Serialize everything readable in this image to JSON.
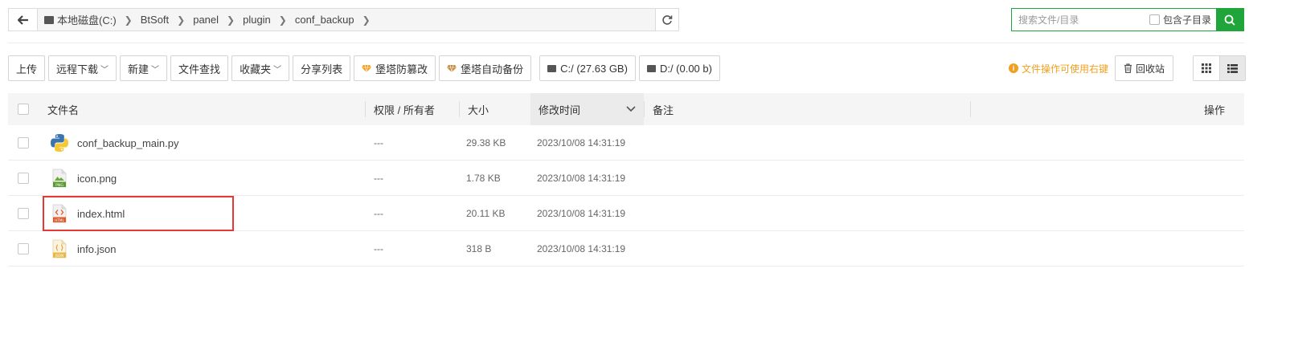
{
  "pathbar": {
    "crumbs": [
      "本地磁盘(C:)",
      "BtSoft",
      "panel",
      "plugin",
      "conf_backup"
    ]
  },
  "search": {
    "placeholder": "搜索文件/目录",
    "subdir_label": "包含子目录"
  },
  "toolbar": {
    "upload": "上传",
    "remote_download": "远程下载",
    "new": "新建",
    "file_search": "文件查找",
    "favorites": "收藏夹",
    "share_list": "分享列表",
    "tamper_proof": "堡塔防篡改",
    "auto_backup": "堡塔自动备份",
    "disk_c": "C:/ (27.63 GB)",
    "disk_d": "D:/ (0.00 b)"
  },
  "right_tools": {
    "hint": "文件操作可使用右键",
    "recycle": "回收站"
  },
  "table": {
    "headers": {
      "name": "文件名",
      "perm": "权限 / 所有者",
      "size": "大小",
      "mtime": "修改时间",
      "note": "备注",
      "ops": "操作"
    },
    "rows": [
      {
        "name": "conf_backup_main.py",
        "perm": "---",
        "size": "29.38 KB",
        "mtime": "2023/10/08 14:31:19",
        "icon": "python-file-icon"
      },
      {
        "name": "icon.png",
        "perm": "---",
        "size": "1.78 KB",
        "mtime": "2023/10/08 14:31:19",
        "icon": "png-file-icon"
      },
      {
        "name": "index.html",
        "perm": "---",
        "size": "20.11 KB",
        "mtime": "2023/10/08 14:31:19",
        "icon": "html-file-icon"
      },
      {
        "name": "info.json",
        "perm": "---",
        "size": "318 B",
        "mtime": "2023/10/08 14:31:19",
        "icon": "json-file-icon"
      }
    ]
  },
  "colors": {
    "accent_green": "#20a53a",
    "hint_orange": "#f0a020",
    "highlight_red": "#e53935"
  }
}
